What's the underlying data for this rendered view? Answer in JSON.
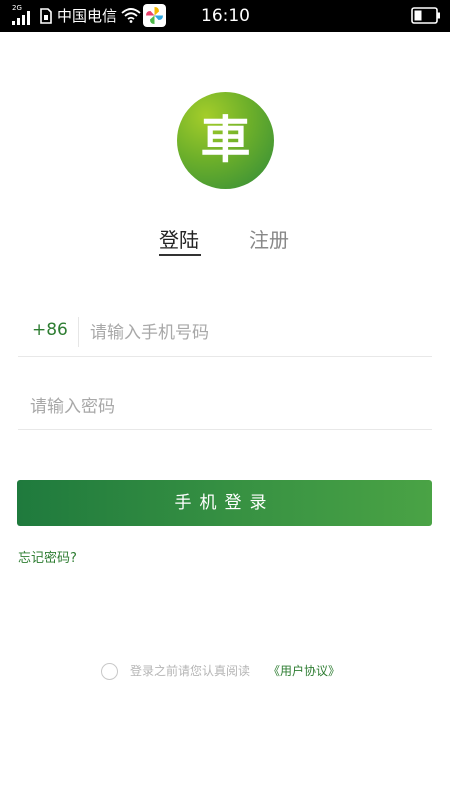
{
  "status_bar": {
    "network_type": "2G",
    "carrier": "中国电信",
    "time": "16:10",
    "signal_icon": "signal-icon",
    "wifi_icon": "wifi-icon",
    "battery_icon": "battery-icon",
    "app_icon": "pinwheel-app-icon"
  },
  "logo": {
    "char": "車",
    "icon": "car-logo-icon"
  },
  "tabs": [
    {
      "label": "登陆",
      "active": true
    },
    {
      "label": "注册",
      "active": false
    }
  ],
  "form": {
    "country_code": "+86",
    "phone_placeholder": "请输入手机号码",
    "password_placeholder": "请输入密码"
  },
  "login_button_label": "手机登录",
  "forgot_password_label": "忘记密码?",
  "agreement": {
    "text": "登录之前请您认真阅读",
    "link": "《用户协议》"
  },
  "colors": {
    "accent": "#2e7d32",
    "status_bar_bg": "#000000"
  }
}
